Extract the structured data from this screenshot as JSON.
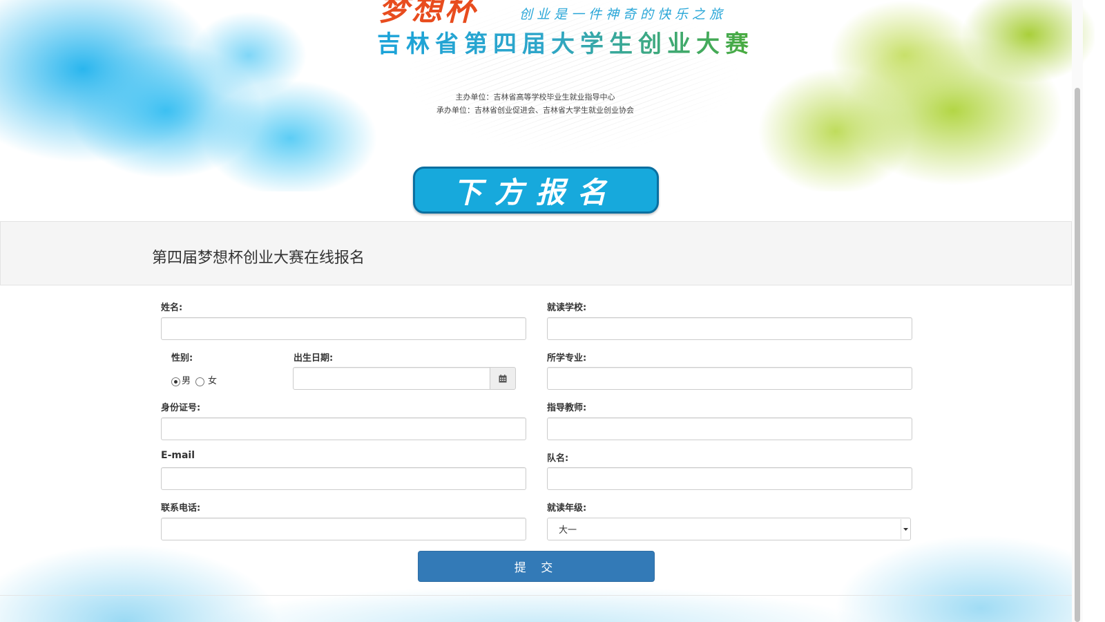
{
  "banner": {
    "logo_text": "梦想杯",
    "slogan": "创业是一件神奇的快乐之旅",
    "title": "吉林省第四届大学生创业大赛",
    "organizer_line1": "主办单位：吉林省高等学校毕业生就业指导中心",
    "organizer_line2": "承办单位：吉林省创业促进会、吉林省大学生就业创业协会",
    "signup_badge": "下方报名",
    "colors": {
      "blue_ink": "#2ab6ee",
      "green_ink": "#b3d645",
      "badge": "#17a9dc",
      "logo": "#e84c1e"
    }
  },
  "panel": {
    "title": "第四届梦想杯创业大赛在线报名"
  },
  "form": {
    "name_label": "姓名:",
    "school_label": "就读学校:",
    "gender_label": "性别:",
    "gender_options": [
      {
        "label": "男",
        "checked": true
      },
      {
        "label": "女",
        "checked": false
      }
    ],
    "birthdate_label": "出生日期:",
    "major_label": "所学专业:",
    "id_label": "身份证号:",
    "teacher_label": "指导教师:",
    "email_label": "E-mail",
    "team_label": "队名:",
    "phone_label": "联系电话:",
    "grade_label": "就读年级:",
    "grade_selected": "大一",
    "submit_label": "提 交",
    "button_color": "#337ab7"
  },
  "icons": {
    "calendar": "calendar-icon",
    "dropdown": "chevron-down-icon"
  }
}
